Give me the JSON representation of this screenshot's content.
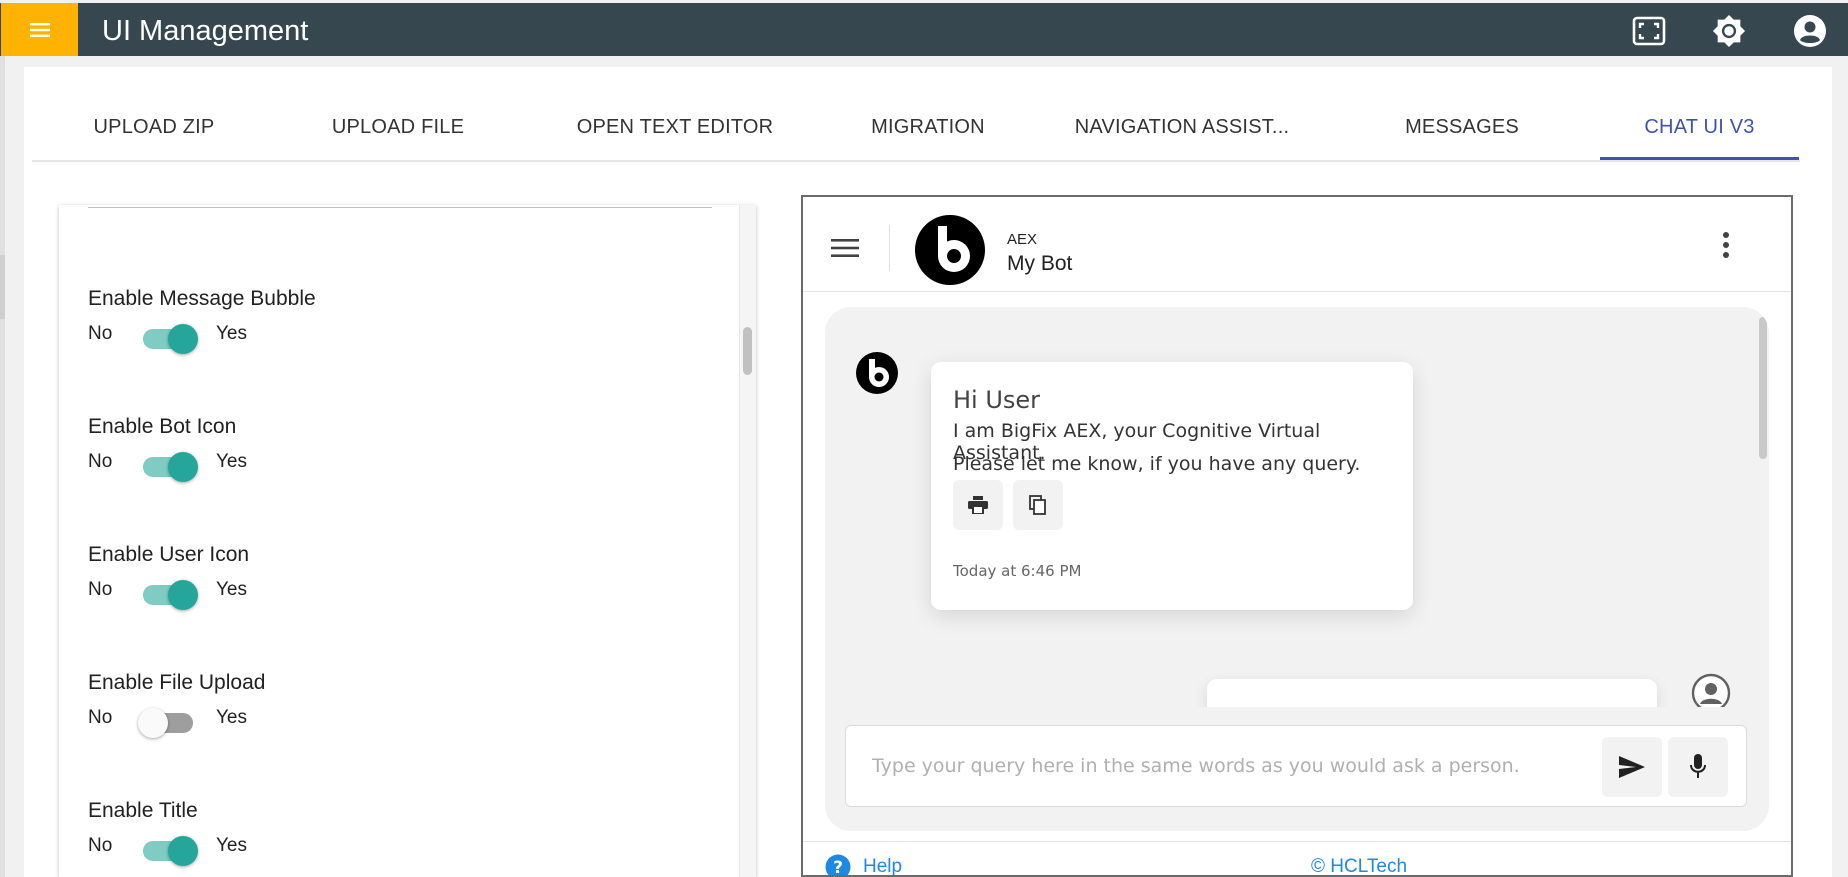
{
  "app": {
    "title": "UI Management"
  },
  "tabs": [
    {
      "label": "UPLOAD ZIP"
    },
    {
      "label": "UPLOAD FILE"
    },
    {
      "label": "OPEN TEXT EDITOR"
    },
    {
      "label": "MIGRATION"
    },
    {
      "label": "NAVIGATION ASSIST..."
    },
    {
      "label": "MESSAGES"
    },
    {
      "label": "CHAT UI V3",
      "active": true
    }
  ],
  "settings": [
    {
      "label": "Enable Message Bubble",
      "no": "No",
      "yes": "Yes",
      "enabled": true
    },
    {
      "label": "Enable Bot Icon",
      "no": "No",
      "yes": "Yes",
      "enabled": true
    },
    {
      "label": "Enable User Icon",
      "no": "No",
      "yes": "Yes",
      "enabled": true
    },
    {
      "label": "Enable File Upload",
      "no": "No",
      "yes": "Yes",
      "enabled": false
    },
    {
      "label": "Enable Title",
      "no": "No",
      "yes": "Yes",
      "enabled": true
    }
  ],
  "chat": {
    "bot_subtitle": "AEX",
    "bot_name": "My Bot",
    "message": {
      "greeting": "Hi User",
      "line1": "I am BigFix AEX, your Cognitive Virtual Assistant.",
      "line2": "Please let me know, if you have any query.",
      "timestamp": "Today at 6:46 PM"
    },
    "composer_placeholder": "Type your query here in the same words as you would ask a person.",
    "footer_help": "Help",
    "footer_copyright": "© HCLTech"
  },
  "colors": {
    "topbar": "#37474f",
    "menu_button": "#ffb300",
    "accent": "#3f51b5",
    "toggle_on": "#26a69a",
    "link": "#1e88e5"
  }
}
